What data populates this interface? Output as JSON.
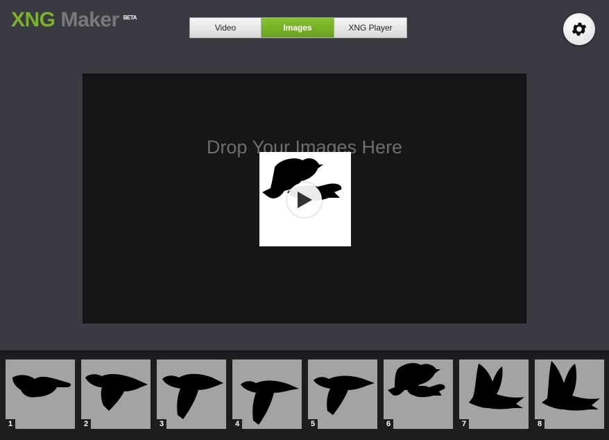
{
  "app": {
    "logo_primary": "XNG",
    "logo_secondary": "Maker",
    "logo_badge": "BETA"
  },
  "tabs": [
    {
      "label": "Video",
      "active": false
    },
    {
      "label": "Images",
      "active": true
    },
    {
      "label": "XNG Player",
      "active": false
    }
  ],
  "settings": {
    "icon": "gear-icon"
  },
  "dropzone": {
    "text": "Drop Your Images Here",
    "play_icon": "play-icon"
  },
  "thumbnails": [
    {
      "number": "1"
    },
    {
      "number": "2"
    },
    {
      "number": "3"
    },
    {
      "number": "4"
    },
    {
      "number": "5"
    },
    {
      "number": "6"
    },
    {
      "number": "7"
    },
    {
      "number": "8"
    }
  ],
  "colors": {
    "accent": "#7bb22a",
    "background": "#3a3a42",
    "dropzone": "#151618",
    "strip": "#1d1d20",
    "thumb_bg": "#a3a3a6"
  }
}
